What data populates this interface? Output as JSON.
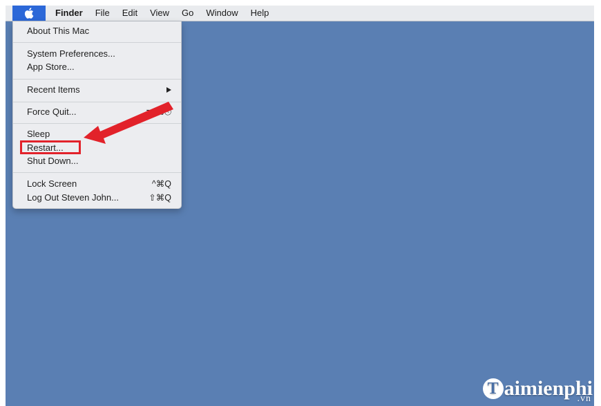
{
  "menubar": {
    "apple_icon": "apple-logo-icon",
    "items": [
      "Finder",
      "File",
      "Edit",
      "View",
      "Go",
      "Window",
      "Help"
    ]
  },
  "apple_menu": {
    "about": "About This Mac",
    "system_prefs": "System Preferences...",
    "app_store": "App Store...",
    "recent_items": "Recent Items",
    "force_quit": "Force Quit...",
    "force_quit_shortcut": "⌥⌘⎋",
    "sleep": "Sleep",
    "restart": "Restart...",
    "shut_down": "Shut Down...",
    "lock_screen": "Lock Screen",
    "lock_screen_shortcut": "^⌘Q",
    "log_out": "Log Out Steven John...",
    "log_out_shortcut": "⇧⌘Q"
  },
  "annotation": {
    "highlight_color": "#e2222a",
    "target": "Restart..."
  },
  "colors": {
    "desktop": "#5a7fb3",
    "menu_bg": "#ecedf0",
    "apple_highlight": "#2c68d8"
  },
  "watermark": {
    "logo_letter": "T",
    "text": "aimienphi",
    "suffix": ".vn"
  }
}
